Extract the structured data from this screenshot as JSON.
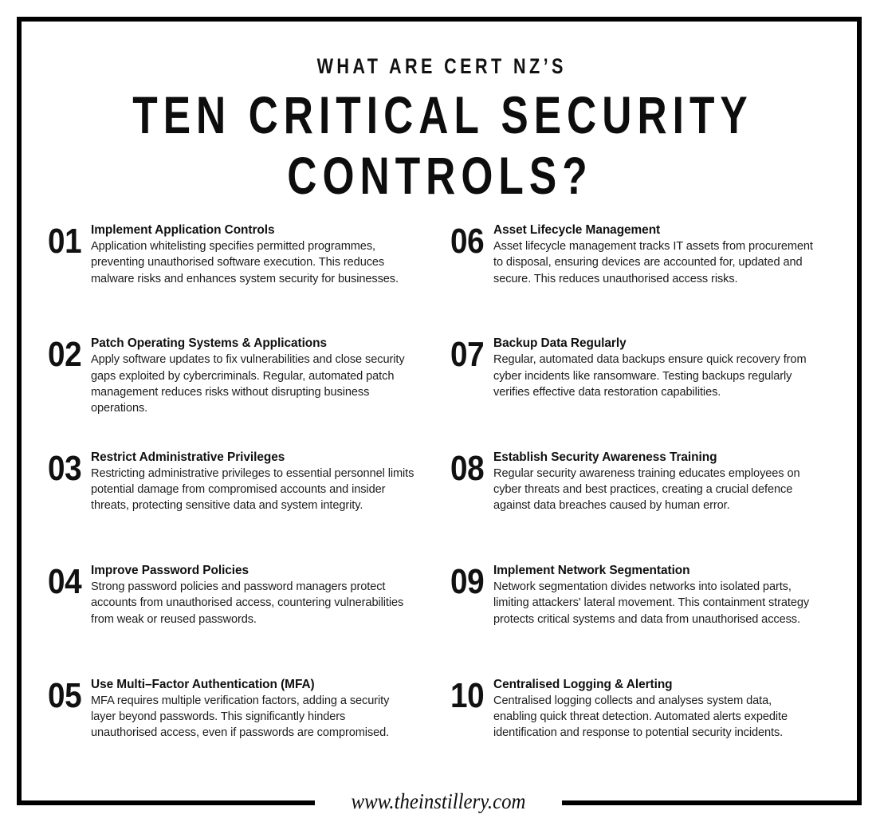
{
  "poster": {
    "background_color": "#ffffff",
    "border_color": "#000000",
    "text_color": "#1a1a1a"
  },
  "header": {
    "eyebrow": "WHAT ARE CERT NZ’S",
    "headline": "TEN CRITICAL SECURITY CONTROLS?"
  },
  "controls": {
    "left_column": [
      {
        "number": "01",
        "title": "Implement Application Controls",
        "description": "Application whitelisting specifies permitted programmes, preventing unauthorised software execution. This reduces malware risks and enhances system security for businesses."
      },
      {
        "number": "02",
        "title": "Patch Operating Systems & Applications",
        "description": "Apply software updates to fix vulnerabilities and close security gaps exploited by cybercriminals. Regular, automated patch management reduces risks without disrupting business operations."
      },
      {
        "number": "03",
        "title": "Restrict Administrative Privileges",
        "description": "Restricting administrative privileges to essential personnel limits potential damage from compromised accounts and insider threats, protecting sensitive data and system integrity."
      },
      {
        "number": "04",
        "title": "Improve Password Policies",
        "description": "Strong password policies and password managers protect accounts from unauthorised access, countering vulnerabilities from weak or reused passwords."
      },
      {
        "number": "05",
        "title": "Use Multi–Factor Authentication (MFA)",
        "description": "MFA requires multiple verification factors, adding a security layer beyond passwords. This significantly hinders unauthorised access, even if passwords are compromised."
      }
    ],
    "right_column": [
      {
        "number": "06",
        "title": "Asset Lifecycle Management",
        "description": "Asset lifecycle management tracks IT assets from procurement to disposal, ensuring devices are accounted for, updated and secure. This reduces unauthorised access risks."
      },
      {
        "number": "07",
        "title": "Backup Data Regularly",
        "description": "Regular, automated data backups ensure quick recovery from cyber incidents like ransomware. Testing backups regularly verifies effective data restoration capabilities."
      },
      {
        "number": "08",
        "title": "Establish Security Awareness Training",
        "description": "Regular security awareness training educates employees on cyber threats and best practices, creating a crucial defence against data breaches caused by human error."
      },
      {
        "number": "09",
        "title": "Implement Network Segmentation",
        "description": "Network segmentation divides networks into isolated parts, limiting attackers' lateral movement. This containment strategy protects critical systems and data from unauthorised access."
      },
      {
        "number": "10",
        "title": "Centralised Logging & Alerting",
        "description": "Centralised logging collects and analyses system data, enabling quick threat detection. Automated alerts expedite identification and response to potential security incidents."
      }
    ]
  },
  "footer": {
    "url": "www.theinstillery.com"
  }
}
